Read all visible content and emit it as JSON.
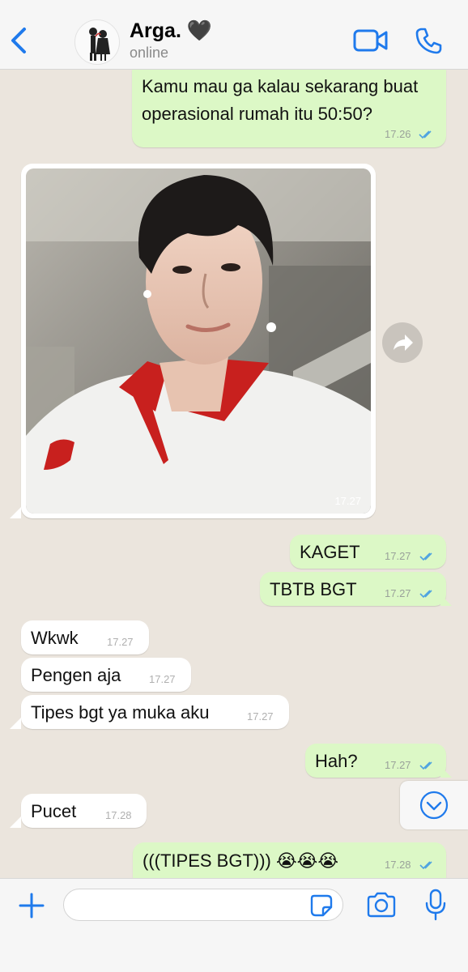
{
  "header": {
    "contact_name": "Arga. 🖤",
    "status": "online",
    "icons": {
      "back": "chevron-left-icon",
      "video": "video-camera-icon",
      "call": "phone-icon"
    },
    "accent_color": "#1f7aec"
  },
  "messages": [
    {
      "direction": "outgoing",
      "text": "Kamu mau ga kalau sekarang buat",
      "text_line2": "operasional rumah itu 50:50?",
      "time": "17.26",
      "read": true
    },
    {
      "direction": "incoming",
      "type": "photo",
      "time": "17.27"
    },
    {
      "direction": "outgoing",
      "text": "KAGET",
      "time": "17.27",
      "read": true
    },
    {
      "direction": "outgoing",
      "text": "TBTB BGT",
      "time": "17.27",
      "read": true
    },
    {
      "direction": "incoming",
      "text": "Wkwk",
      "time": "17.27"
    },
    {
      "direction": "incoming",
      "text": "Pengen aja",
      "time": "17.27"
    },
    {
      "direction": "incoming",
      "text": "Tipes bgt ya muka aku",
      "time": "17.27"
    },
    {
      "direction": "outgoing",
      "text": "Hah?",
      "time": "17.27",
      "read": true
    },
    {
      "direction": "incoming",
      "text": "Pucet",
      "time": "17.28"
    },
    {
      "direction": "outgoing",
      "text": "(((TIPES BGT))) 😭😭😭",
      "time": "17.28",
      "read": true
    }
  ],
  "composer": {
    "placeholder": "",
    "icons": {
      "attach": "plus-icon",
      "sticker": "sticker-icon",
      "camera": "camera-icon",
      "mic": "microphone-icon"
    }
  },
  "colors": {
    "outgoing_bubble": "#dcf8c6",
    "incoming_bubble": "#ffffff",
    "chat_background": "#ebe5dd",
    "read_ticks": "#4fa3e0"
  }
}
